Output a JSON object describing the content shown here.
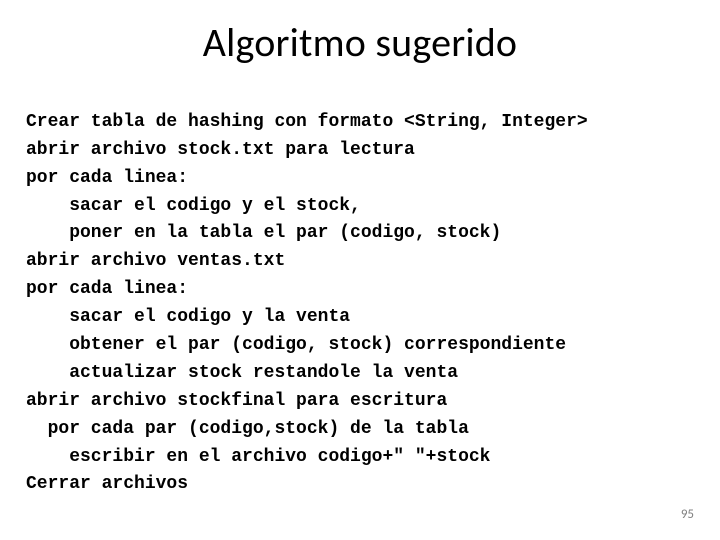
{
  "title": "Algoritmo sugerido",
  "lines": {
    "l0": "Crear tabla de hashing con formato <String, Integer>",
    "l1": "abrir archivo stock.txt para lectura",
    "l2": "por cada linea:",
    "l3": "    sacar el codigo y el stock,",
    "l4": "    poner en la tabla el par (codigo, stock)",
    "l5": "abrir archivo ventas.txt",
    "l6": "por cada linea:",
    "l7": "    sacar el codigo y la venta",
    "l8": "    obtener el par (codigo, stock) correspondiente",
    "l9": "    actualizar stock restandole la venta",
    "l10": "abrir archivo stockfinal para escritura",
    "l11": "  por cada par (codigo,stock) de la tabla",
    "l12": "    escribir en el archivo codigo+\" \"+stock",
    "l13": "Cerrar archivos"
  },
  "page_number": "95"
}
